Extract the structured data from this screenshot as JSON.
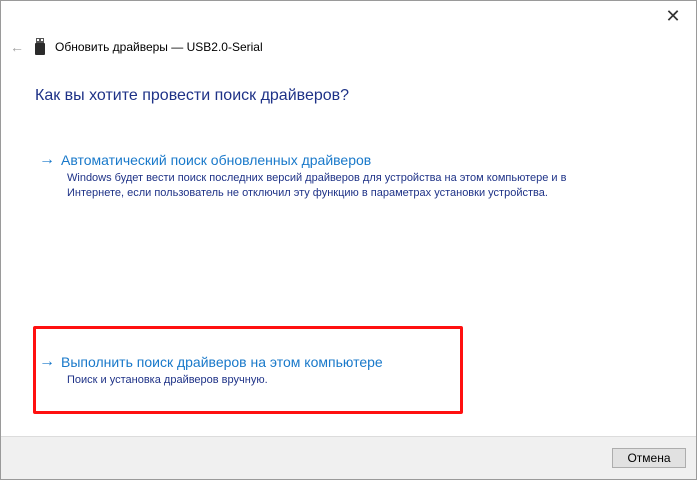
{
  "window": {
    "title": "Обновить драйверы — USB2.0-Serial",
    "close_glyph": "✕",
    "back_glyph": "←"
  },
  "heading": "Как вы хотите провести поиск драйверов?",
  "options": [
    {
      "arrow": "→",
      "title": "Автоматический поиск обновленных драйверов",
      "description_line1": "Windows будет вести поиск последних версий драйверов для устройства на этом компьютере и в",
      "description_line2": "Интернете, если пользователь не отключил эту функцию в параметрах установки устройства."
    },
    {
      "arrow": "→",
      "title": "Выполнить поиск драйверов на этом компьютере",
      "description_line1": "Поиск и установка драйверов вручную."
    }
  ],
  "footer": {
    "cancel_label": "Отмена"
  },
  "colors": {
    "link": "#1979ca",
    "heading": "#1e3287",
    "highlight": "#ff1010"
  },
  "icons": {
    "back": "back-arrow-icon",
    "device": "usb-device-icon",
    "close": "close-icon"
  }
}
